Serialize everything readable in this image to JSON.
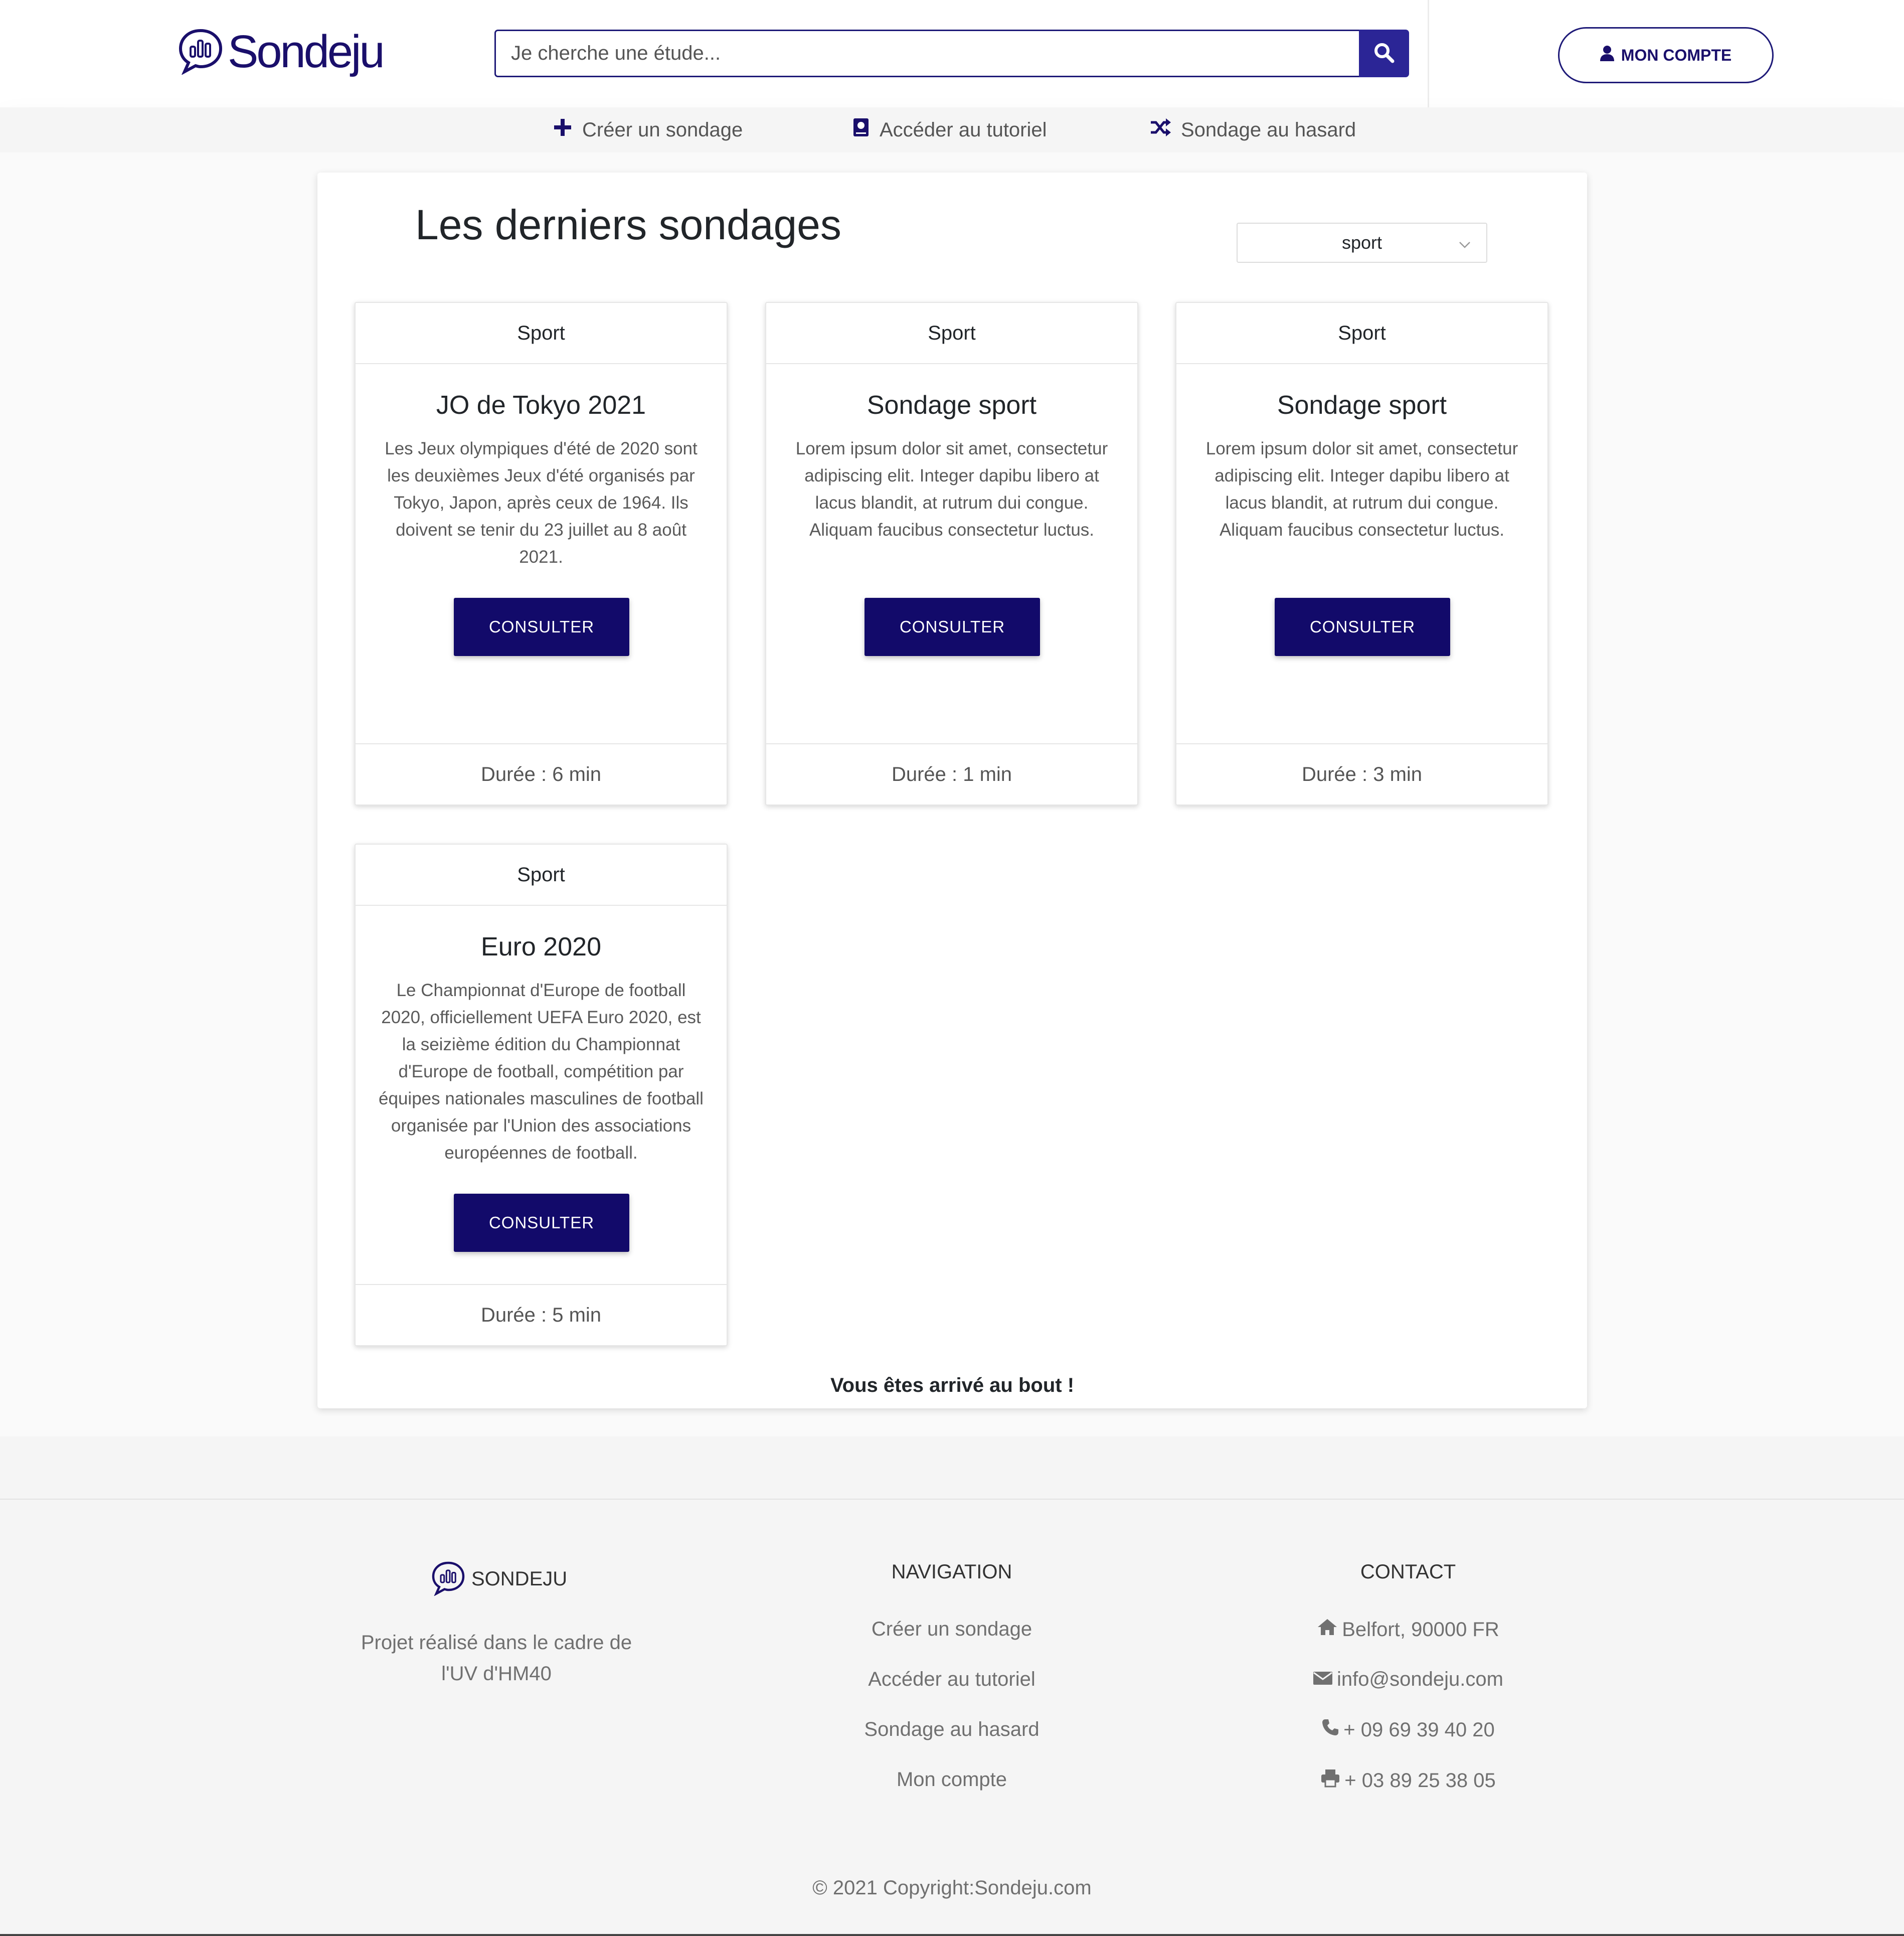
{
  "header": {
    "logo_text": "Sondeju",
    "search_placeholder": "Je cherche une étude...",
    "account_label": "MON COMPTE"
  },
  "subnav": {
    "items": [
      {
        "label": "Créer un sondage",
        "icon": "plus-icon"
      },
      {
        "label": "Accéder au tutoriel",
        "icon": "book-icon"
      },
      {
        "label": "Sondage au hasard",
        "icon": "shuffle-icon"
      }
    ]
  },
  "main": {
    "title": "Les derniers sondages",
    "filter_value": "sport",
    "cards": [
      {
        "category": "Sport",
        "title": "JO de Tokyo 2021",
        "description": "Les Jeux olympiques d'été de 2020 sont les deuxièmes Jeux d'été organisés par Tokyo, Japon, après ceux de 1964. Ils doivent se tenir du 23 juillet au 8 août 2021.",
        "button": "CONSULTER",
        "duration": "Durée : 6 min"
      },
      {
        "category": "Sport",
        "title": "Sondage sport",
        "description": "Lorem ipsum dolor sit amet, consectetur adipiscing elit. Integer dapibu libero at lacus blandit, at rutrum dui congue. Aliquam faucibus consectetur luctus.",
        "button": "CONSULTER",
        "duration": "Durée : 1 min"
      },
      {
        "category": "Sport",
        "title": "Sondage sport",
        "description": "Lorem ipsum dolor sit amet, consectetur adipiscing elit. Integer dapibu libero at lacus blandit, at rutrum dui congue. Aliquam faucibus consectetur luctus.",
        "button": "CONSULTER",
        "duration": "Durée : 3 min"
      },
      {
        "category": "Sport",
        "title": "Euro 2020",
        "description": "Le Championnat d'Europe de football 2020, officiellement UEFA Euro 2020, est la seizième édition du Championnat d'Europe de football, compétition par équipes nationales masculines de football organisée par l'Union des associations européennes de football.",
        "button": "CONSULTER",
        "duration": "Durée : 5 min"
      }
    ],
    "end_message": "Vous êtes arrivé au bout !"
  },
  "footer": {
    "brand": "SONDEJU",
    "brand_text": "Projet réalisé dans le cadre de l'UV d'HM40",
    "navigation_title": "NAVIGATION",
    "navigation_links": [
      "Créer un sondage",
      "Accéder au tutoriel",
      "Sondage au hasard",
      "Mon compte"
    ],
    "contact_title": "CONTACT",
    "contact": [
      {
        "icon": "home-icon",
        "text": "Belfort, 90000 FR"
      },
      {
        "icon": "envelope-icon",
        "text": "info@sondeju.com"
      },
      {
        "icon": "phone-icon",
        "text": "+ 09 69 39 40 20"
      },
      {
        "icon": "printer-icon",
        "text": "+ 03 89 25 38 05"
      }
    ],
    "copyright": "© 2021 Copyright:Sondeju.com"
  },
  "colors": {
    "brand": "#1a0f6b",
    "button": "#120a6a",
    "search_button": "#2b2596"
  }
}
